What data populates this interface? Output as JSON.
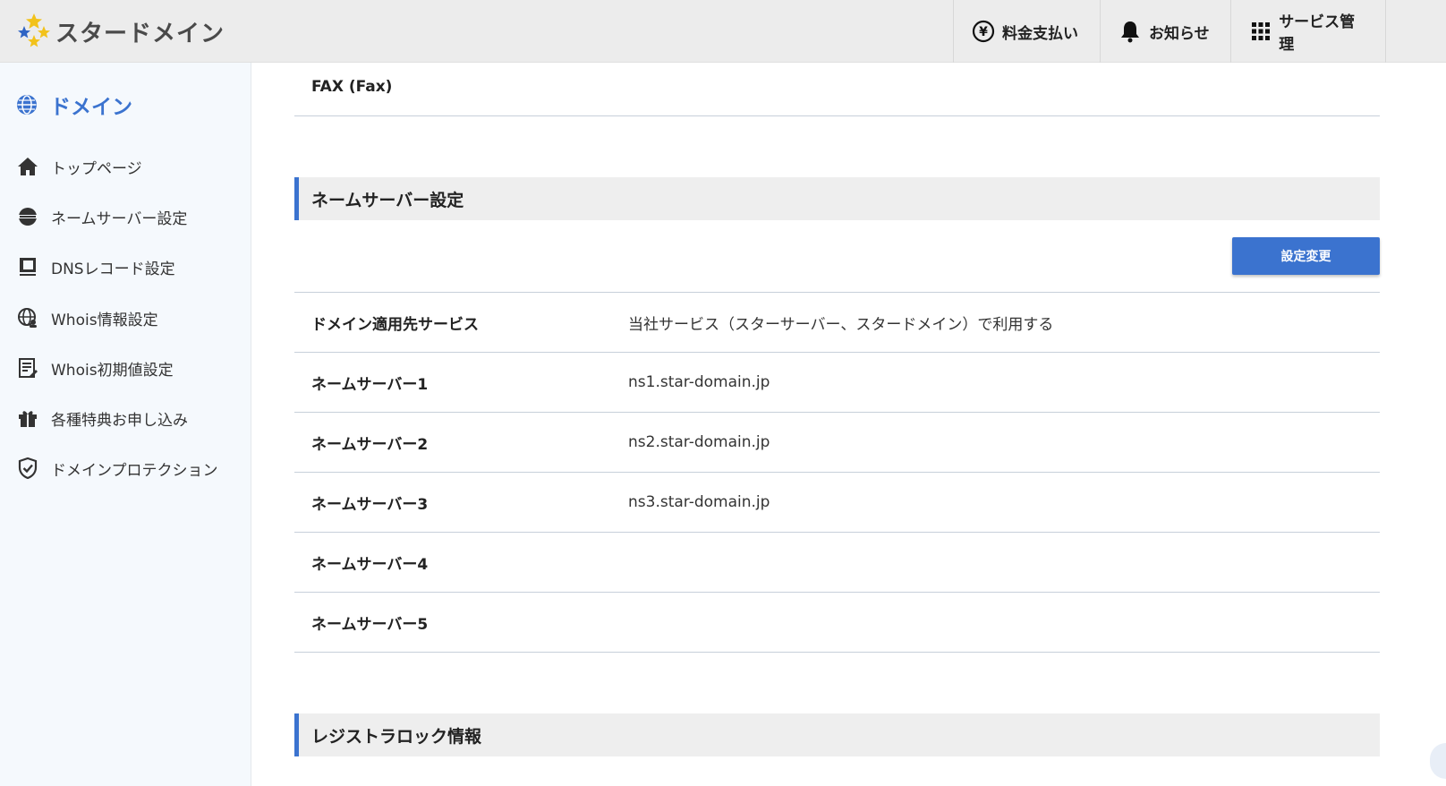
{
  "header": {
    "logo_text": "スタードメイン",
    "items": [
      {
        "label": "料金支払い",
        "icon": "yen-circle-icon"
      },
      {
        "label": "お知らせ",
        "icon": "bell-icon"
      },
      {
        "label": "サービス管理",
        "icon": "grid-icon"
      }
    ],
    "accent_color": "#3b73cf"
  },
  "sidebar": {
    "title": "ドメイン",
    "items": [
      {
        "label": "トップページ",
        "icon": "home-icon"
      },
      {
        "label": "ネームサーバー設定",
        "icon": "server-globe-icon"
      },
      {
        "label": "DNSレコード設定",
        "icon": "book-icon"
      },
      {
        "label": "Whois情報設定",
        "icon": "globe-user-icon"
      },
      {
        "label": "Whois初期値設定",
        "icon": "form-edit-icon"
      },
      {
        "label": "各種特典お申し込み",
        "icon": "gift-icon"
      },
      {
        "label": "ドメインプロテクション",
        "icon": "shield-check-icon"
      }
    ]
  },
  "main": {
    "fax_label": "FAX (Fax)",
    "ns_section_title": "ネームサーバー設定",
    "change_button": "設定変更",
    "ns_rows": [
      {
        "label": "ドメイン適用先サービス",
        "value": "当社サービス（スターサーバー、スタードメイン）で利用する"
      },
      {
        "label": "ネームサーバー1",
        "value": "ns1.star-domain.jp"
      },
      {
        "label": "ネームサーバー2",
        "value": "ns2.star-domain.jp"
      },
      {
        "label": "ネームサーバー3",
        "value": "ns3.star-domain.jp"
      },
      {
        "label": "ネームサーバー4",
        "value": ""
      },
      {
        "label": "ネームサーバー5",
        "value": ""
      }
    ],
    "lock_section_title": "レジストラロック情報"
  }
}
